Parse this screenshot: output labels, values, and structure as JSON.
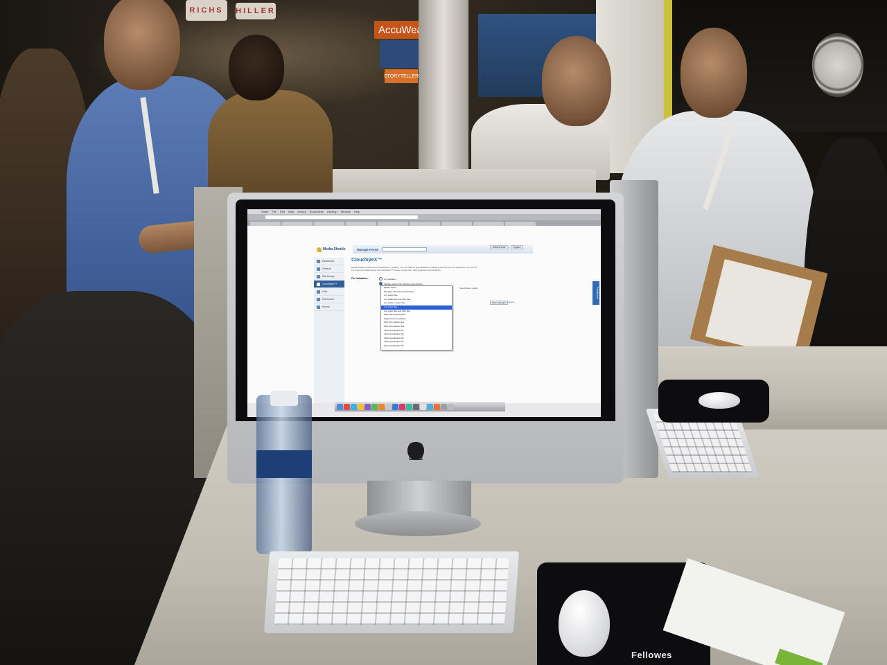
{
  "booth": {
    "banner_left": "RICHS",
    "banner_right": "HILLER",
    "sign_brand": "AccuWeath",
    "sign_storyteller": "STORYTELLER"
  },
  "screen": {
    "menubar_items": [
      "Safari",
      "File",
      "Edit",
      "View",
      "History",
      "Bookmarks",
      "Develop",
      "Window",
      "Help"
    ],
    "app": {
      "logo_text": "Media Shuttle",
      "nav_title": "Manage Portal",
      "top_buttons": [
        "What's New",
        "Logout"
      ],
      "sidebar": [
        "Dashboard",
        "General",
        "Site Design",
        "CloudSpeX™",
        "Files",
        "Extensions",
        "Events"
      ],
      "active_sidebar_index": 3,
      "page_title": "CloudSpeX™",
      "intro_lines": [
        "Media Shuttle portals can be CloudSpeX™ enabled. You can select a specification for validating the files that are uploaded to your portal.",
        "For more information about the CloudSpeX™ service, please visit: www.signiant.com/CloudSpeX"
      ],
      "validation_label": "File Validation:",
      "radio_none": "No validation",
      "radio_validate": "Validate against the following specification:",
      "spec_results_label": "Specification results",
      "dropdown_options": [
        "Please select...",
        "202 (Sg's A5 testing specification",
        "Any audio files",
        "Any audio files and XML files",
        "Any audio or video files",
        "Any video files",
        "Any video files and XML files",
        "DPP AS11 Specification",
        "Digital Cinema package",
        "MXF with indexer files",
        "MXF with indexer files",
        "cTest specification #1",
        "cTest specification #2",
        "cTest specification #3",
        "cTest specification #4",
        "cTest specification #5"
      ],
      "selected_option_index": 5,
      "save_button": "Save Changes",
      "cancel_link": "Cancel",
      "feedback_tab": "Feedback"
    }
  },
  "desk": {
    "mousepad_brand": "Fellowes"
  }
}
